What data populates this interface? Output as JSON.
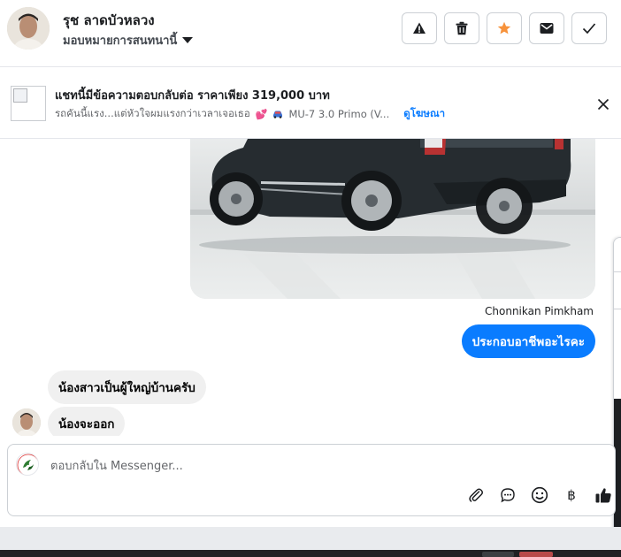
{
  "header": {
    "contact_name": "รุช ลาดบัวหลวง",
    "assign_label": "มอบหมายการสนทนานี้",
    "actions": [
      {
        "icon": "warning-icon",
        "label": "report"
      },
      {
        "icon": "trash-icon",
        "label": "delete"
      },
      {
        "icon": "star-icon",
        "label": "star"
      },
      {
        "icon": "mail-icon",
        "label": "mark unread"
      },
      {
        "icon": "check-icon",
        "label": "done"
      }
    ],
    "star_color": "#f7923b"
  },
  "banner": {
    "title": "แชทนี้มีข้อความตอบกลับต่อ ราคาเพียง 319,000 บาท",
    "snippet": "รถคันนี้แรง...แต่หัวใจผมแรงกว่าเวลาเจอเธอ",
    "heart": "💕",
    "product": "MU-7 3.0 Primo (V...",
    "link": "ดูโฆษณา"
  },
  "thread": {
    "sender_name": "Chonnikan Pimkham",
    "outgoing": "ประกอบอาชีพอะไรคะ",
    "incoming": [
      "น้องสาวเป็นผู้ใหญ่บ้านครับ",
      "น้องจะออก"
    ]
  },
  "composer": {
    "placeholder": "ตอบกลับใน Messenger...",
    "baht_symbol": "฿",
    "accent": "#0a7cff"
  }
}
